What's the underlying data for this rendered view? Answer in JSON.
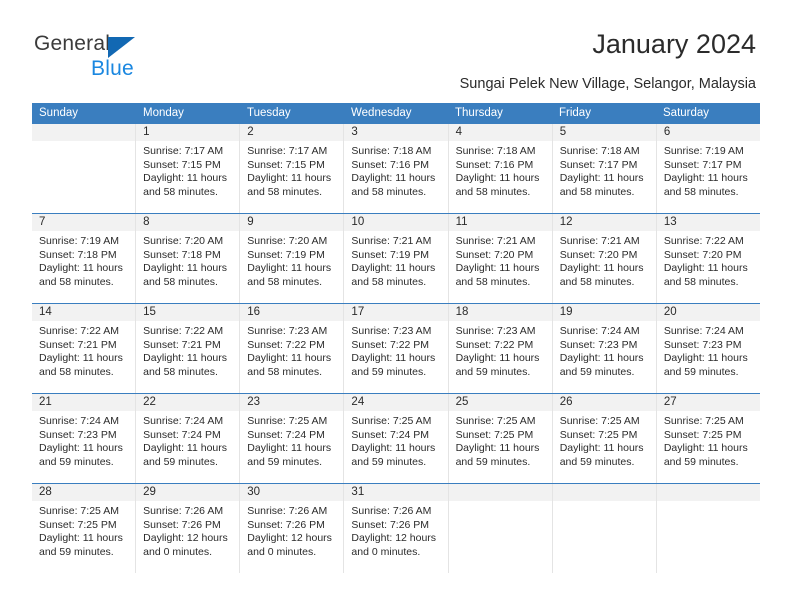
{
  "brand": {
    "word_one": "General",
    "word_two": "Blue",
    "triangle_color": "#1268b3",
    "blue_color": "#1a87e0"
  },
  "header": {
    "title": "January 2024",
    "subtitle": "Sungai Pelek New Village, Selangor, Malaysia"
  },
  "theme": {
    "header_bg": "#3a7ebf",
    "header_text": "#ffffff",
    "day_band_bg": "#f2f2f2",
    "divider": "#3a7ebf"
  },
  "calendar": {
    "weekdays": [
      "Sunday",
      "Monday",
      "Tuesday",
      "Wednesday",
      "Thursday",
      "Friday",
      "Saturday"
    ],
    "weeks": [
      [
        {
          "day": "",
          "sunrise": "",
          "sunset": "",
          "daylight_1": "",
          "daylight_2": ""
        },
        {
          "day": "1",
          "sunrise": "Sunrise: 7:17 AM",
          "sunset": "Sunset: 7:15 PM",
          "daylight_1": "Daylight: 11 hours",
          "daylight_2": "and 58 minutes."
        },
        {
          "day": "2",
          "sunrise": "Sunrise: 7:17 AM",
          "sunset": "Sunset: 7:15 PM",
          "daylight_1": "Daylight: 11 hours",
          "daylight_2": "and 58 minutes."
        },
        {
          "day": "3",
          "sunrise": "Sunrise: 7:18 AM",
          "sunset": "Sunset: 7:16 PM",
          "daylight_1": "Daylight: 11 hours",
          "daylight_2": "and 58 minutes."
        },
        {
          "day": "4",
          "sunrise": "Sunrise: 7:18 AM",
          "sunset": "Sunset: 7:16 PM",
          "daylight_1": "Daylight: 11 hours",
          "daylight_2": "and 58 minutes."
        },
        {
          "day": "5",
          "sunrise": "Sunrise: 7:18 AM",
          "sunset": "Sunset: 7:17 PM",
          "daylight_1": "Daylight: 11 hours",
          "daylight_2": "and 58 minutes."
        },
        {
          "day": "6",
          "sunrise": "Sunrise: 7:19 AM",
          "sunset": "Sunset: 7:17 PM",
          "daylight_1": "Daylight: 11 hours",
          "daylight_2": "and 58 minutes."
        }
      ],
      [
        {
          "day": "7",
          "sunrise": "Sunrise: 7:19 AM",
          "sunset": "Sunset: 7:18 PM",
          "daylight_1": "Daylight: 11 hours",
          "daylight_2": "and 58 minutes."
        },
        {
          "day": "8",
          "sunrise": "Sunrise: 7:20 AM",
          "sunset": "Sunset: 7:18 PM",
          "daylight_1": "Daylight: 11 hours",
          "daylight_2": "and 58 minutes."
        },
        {
          "day": "9",
          "sunrise": "Sunrise: 7:20 AM",
          "sunset": "Sunset: 7:19 PM",
          "daylight_1": "Daylight: 11 hours",
          "daylight_2": "and 58 minutes."
        },
        {
          "day": "10",
          "sunrise": "Sunrise: 7:21 AM",
          "sunset": "Sunset: 7:19 PM",
          "daylight_1": "Daylight: 11 hours",
          "daylight_2": "and 58 minutes."
        },
        {
          "day": "11",
          "sunrise": "Sunrise: 7:21 AM",
          "sunset": "Sunset: 7:20 PM",
          "daylight_1": "Daylight: 11 hours",
          "daylight_2": "and 58 minutes."
        },
        {
          "day": "12",
          "sunrise": "Sunrise: 7:21 AM",
          "sunset": "Sunset: 7:20 PM",
          "daylight_1": "Daylight: 11 hours",
          "daylight_2": "and 58 minutes."
        },
        {
          "day": "13",
          "sunrise": "Sunrise: 7:22 AM",
          "sunset": "Sunset: 7:20 PM",
          "daylight_1": "Daylight: 11 hours",
          "daylight_2": "and 58 minutes."
        }
      ],
      [
        {
          "day": "14",
          "sunrise": "Sunrise: 7:22 AM",
          "sunset": "Sunset: 7:21 PM",
          "daylight_1": "Daylight: 11 hours",
          "daylight_2": "and 58 minutes."
        },
        {
          "day": "15",
          "sunrise": "Sunrise: 7:22 AM",
          "sunset": "Sunset: 7:21 PM",
          "daylight_1": "Daylight: 11 hours",
          "daylight_2": "and 58 minutes."
        },
        {
          "day": "16",
          "sunrise": "Sunrise: 7:23 AM",
          "sunset": "Sunset: 7:22 PM",
          "daylight_1": "Daylight: 11 hours",
          "daylight_2": "and 58 minutes."
        },
        {
          "day": "17",
          "sunrise": "Sunrise: 7:23 AM",
          "sunset": "Sunset: 7:22 PM",
          "daylight_1": "Daylight: 11 hours",
          "daylight_2": "and 59 minutes."
        },
        {
          "day": "18",
          "sunrise": "Sunrise: 7:23 AM",
          "sunset": "Sunset: 7:22 PM",
          "daylight_1": "Daylight: 11 hours",
          "daylight_2": "and 59 minutes."
        },
        {
          "day": "19",
          "sunrise": "Sunrise: 7:24 AM",
          "sunset": "Sunset: 7:23 PM",
          "daylight_1": "Daylight: 11 hours",
          "daylight_2": "and 59 minutes."
        },
        {
          "day": "20",
          "sunrise": "Sunrise: 7:24 AM",
          "sunset": "Sunset: 7:23 PM",
          "daylight_1": "Daylight: 11 hours",
          "daylight_2": "and 59 minutes."
        }
      ],
      [
        {
          "day": "21",
          "sunrise": "Sunrise: 7:24 AM",
          "sunset": "Sunset: 7:23 PM",
          "daylight_1": "Daylight: 11 hours",
          "daylight_2": "and 59 minutes."
        },
        {
          "day": "22",
          "sunrise": "Sunrise: 7:24 AM",
          "sunset": "Sunset: 7:24 PM",
          "daylight_1": "Daylight: 11 hours",
          "daylight_2": "and 59 minutes."
        },
        {
          "day": "23",
          "sunrise": "Sunrise: 7:25 AM",
          "sunset": "Sunset: 7:24 PM",
          "daylight_1": "Daylight: 11 hours",
          "daylight_2": "and 59 minutes."
        },
        {
          "day": "24",
          "sunrise": "Sunrise: 7:25 AM",
          "sunset": "Sunset: 7:24 PM",
          "daylight_1": "Daylight: 11 hours",
          "daylight_2": "and 59 minutes."
        },
        {
          "day": "25",
          "sunrise": "Sunrise: 7:25 AM",
          "sunset": "Sunset: 7:25 PM",
          "daylight_1": "Daylight: 11 hours",
          "daylight_2": "and 59 minutes."
        },
        {
          "day": "26",
          "sunrise": "Sunrise: 7:25 AM",
          "sunset": "Sunset: 7:25 PM",
          "daylight_1": "Daylight: 11 hours",
          "daylight_2": "and 59 minutes."
        },
        {
          "day": "27",
          "sunrise": "Sunrise: 7:25 AM",
          "sunset": "Sunset: 7:25 PM",
          "daylight_1": "Daylight: 11 hours",
          "daylight_2": "and 59 minutes."
        }
      ],
      [
        {
          "day": "28",
          "sunrise": "Sunrise: 7:25 AM",
          "sunset": "Sunset: 7:25 PM",
          "daylight_1": "Daylight: 11 hours",
          "daylight_2": "and 59 minutes."
        },
        {
          "day": "29",
          "sunrise": "Sunrise: 7:26 AM",
          "sunset": "Sunset: 7:26 PM",
          "daylight_1": "Daylight: 12 hours",
          "daylight_2": "and 0 minutes."
        },
        {
          "day": "30",
          "sunrise": "Sunrise: 7:26 AM",
          "sunset": "Sunset: 7:26 PM",
          "daylight_1": "Daylight: 12 hours",
          "daylight_2": "and 0 minutes."
        },
        {
          "day": "31",
          "sunrise": "Sunrise: 7:26 AM",
          "sunset": "Sunset: 7:26 PM",
          "daylight_1": "Daylight: 12 hours",
          "daylight_2": "and 0 minutes."
        },
        {
          "day": "",
          "sunrise": "",
          "sunset": "",
          "daylight_1": "",
          "daylight_2": ""
        },
        {
          "day": "",
          "sunrise": "",
          "sunset": "",
          "daylight_1": "",
          "daylight_2": ""
        },
        {
          "day": "",
          "sunrise": "",
          "sunset": "",
          "daylight_1": "",
          "daylight_2": ""
        }
      ]
    ]
  }
}
